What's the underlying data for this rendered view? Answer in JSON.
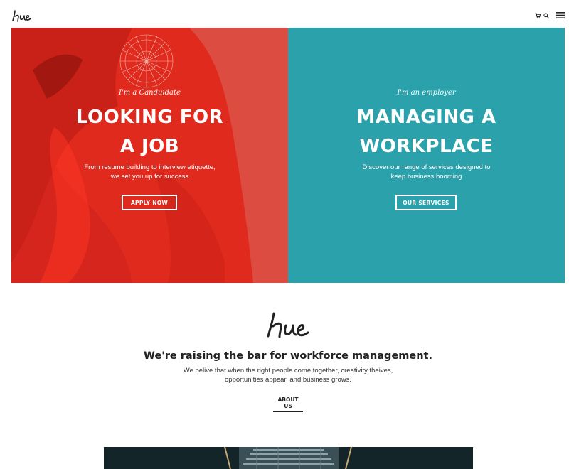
{
  "header": {
    "logo_text": "Hue",
    "icons": [
      "cart-icon",
      "search-icon",
      "menu-icon"
    ]
  },
  "hero": {
    "candidate": {
      "kicker": "I'm a Canduidate",
      "title_line1": "LOOKING FOR",
      "title_line2": "A JOB",
      "text_line1": "From resume building to interview etiquette,",
      "text_line2": "we set you up for success",
      "button_label": "APPLY NOW",
      "bg_color": "#e22a1e"
    },
    "employer": {
      "kicker": "I'm an employer",
      "title_line1": "MANAGING A",
      "title_line2": "WORKPLACE",
      "text_line1": "Discover our range of services designed to",
      "text_line2": "keep business booming",
      "button_label": "OUR SERVICES",
      "bg_color": "#2aa1ab"
    }
  },
  "intro": {
    "logo_text": "Hue",
    "heading": "We're raising the bar for workforce management.",
    "body_line1": "We belive that when the right people come together, creativity theives,",
    "body_line2": "opportunities appear, and business grows.",
    "link_label": "ABOUT US"
  }
}
